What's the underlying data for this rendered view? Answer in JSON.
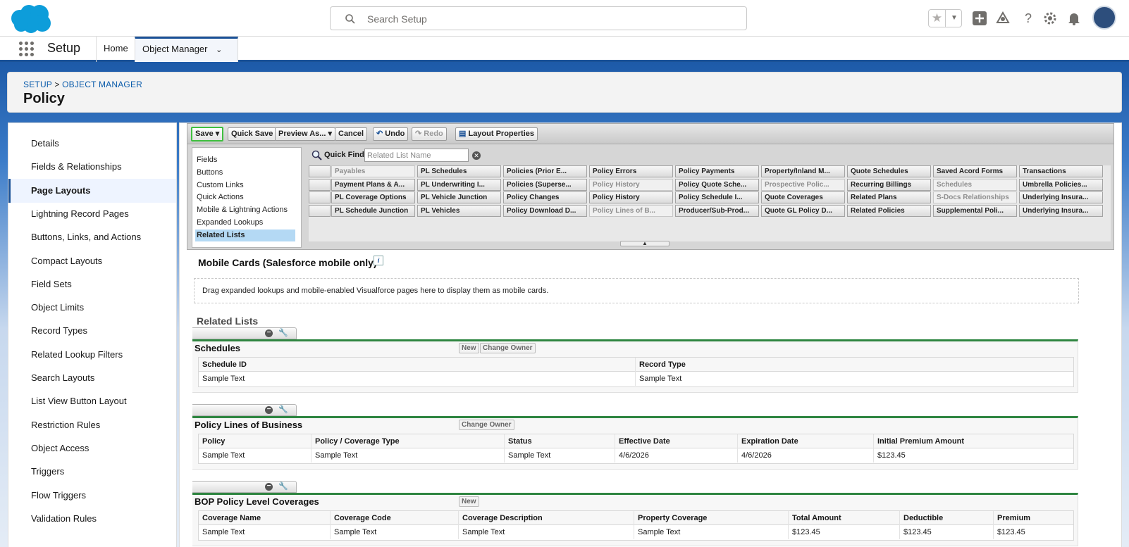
{
  "search": {
    "placeholder": "Search Setup"
  },
  "app": {
    "title": "Setup"
  },
  "nav": {
    "home": "Home",
    "object_manager": "Object Manager"
  },
  "breadcrumb": {
    "setup": "SETUP",
    "separator": ">",
    "object_manager": "OBJECT MANAGER"
  },
  "page": {
    "title": "Policy"
  },
  "sidebar": {
    "items": [
      "Details",
      "Fields & Relationships",
      "Page Layouts",
      "Lightning Record Pages",
      "Buttons, Links, and Actions",
      "Compact Layouts",
      "Field Sets",
      "Object Limits",
      "Record Types",
      "Related Lookup Filters",
      "Search Layouts",
      "List View Button Layout",
      "Restriction Rules",
      "Object Access",
      "Triggers",
      "Flow Triggers",
      "Validation Rules"
    ],
    "active": "Page Layouts"
  },
  "toolbar": {
    "save": "Save",
    "quick_save": "Quick Save",
    "preview_as": "Preview As...",
    "cancel": "Cancel",
    "undo": "Undo",
    "redo": "Redo",
    "layout_properties": "Layout Properties"
  },
  "palette": {
    "categories": [
      "Fields",
      "Buttons",
      "Custom Links",
      "Quick Actions",
      "Mobile & Lightning Actions",
      "Expanded Lookups",
      "Related Lists"
    ],
    "selected_category": "Related Lists",
    "quick_find_label": "Quick Find",
    "quick_find_placeholder": "Related List Name",
    "rows": [
      [
        "Payables",
        "PL Schedules",
        "Policies (Prior E...",
        "Policy Errors",
        "Policy Payments",
        "Property/Inland M...",
        "Quote Schedules",
        "Saved Acord Forms",
        "Transactions"
      ],
      [
        "Payment Plans & A...",
        "PL Underwriting I...",
        "Policies (Superse...",
        "Policy History",
        "Policy Quote Sche...",
        "Prospective Polic...",
        "Recurring Billings",
        "Schedules",
        "Umbrella Policies..."
      ],
      [
        "PL Coverage Options",
        "PL Vehicle Junction",
        "Policy Changes",
        "Policy History",
        "Policy Schedule I...",
        "Quote Coverages",
        "Related Plans",
        "S-Docs Relationships",
        "Underlying Insura..."
      ],
      [
        "PL Schedule Junction",
        "PL Vehicles",
        "Policy Download D...",
        "Policy Lines of B...",
        "Producer/Sub-Prod...",
        "Quote GL Policy D...",
        "Related Policies",
        "Supplemental Poli...",
        "Underlying Insura..."
      ]
    ],
    "used": [
      [
        true,
        false,
        false,
        false,
        false,
        false,
        false,
        false,
        false
      ],
      [
        false,
        false,
        false,
        true,
        false,
        true,
        false,
        true,
        false
      ],
      [
        false,
        false,
        false,
        false,
        false,
        false,
        false,
        true,
        false
      ],
      [
        false,
        false,
        false,
        true,
        false,
        false,
        false,
        false,
        false
      ]
    ]
  },
  "mobile_cards": {
    "title": "Mobile Cards (Salesforce mobile only)",
    "hint": "Drag expanded lookups and mobile-enabled Visualforce pages here to display them as mobile cards."
  },
  "related_lists": {
    "title": "Related Lists",
    "lists": [
      {
        "name": "Schedules",
        "buttons": [
          "New",
          "Change Owner"
        ],
        "columns": [
          "Schedule ID",
          "Record Type"
        ],
        "row": [
          "Sample Text",
          "Sample Text"
        ]
      },
      {
        "name": "Policy Lines of Business",
        "buttons": [
          "Change Owner"
        ],
        "columns": [
          "Policy",
          "Policy / Coverage Type",
          "Status",
          "Effective Date",
          "Expiration Date",
          "Initial Premium Amount"
        ],
        "row": [
          "Sample Text",
          "Sample Text",
          "Sample Text",
          "4/6/2026",
          "4/6/2026",
          "$123.45"
        ]
      },
      {
        "name": "BOP Policy Level Coverages",
        "buttons": [
          "New"
        ],
        "columns": [
          "Coverage Name",
          "Coverage Code",
          "Coverage Description",
          "Property Coverage",
          "Total Amount",
          "Deductible",
          "Premium"
        ],
        "row": [
          "Sample Text",
          "Sample Text",
          "Sample Text",
          "Sample Text",
          "$123.45",
          "$123.45",
          "$123.45"
        ]
      }
    ]
  },
  "colors": {
    "brand": "#1b5297",
    "accent_green": "#2e8540",
    "link": "#0b5cab"
  }
}
